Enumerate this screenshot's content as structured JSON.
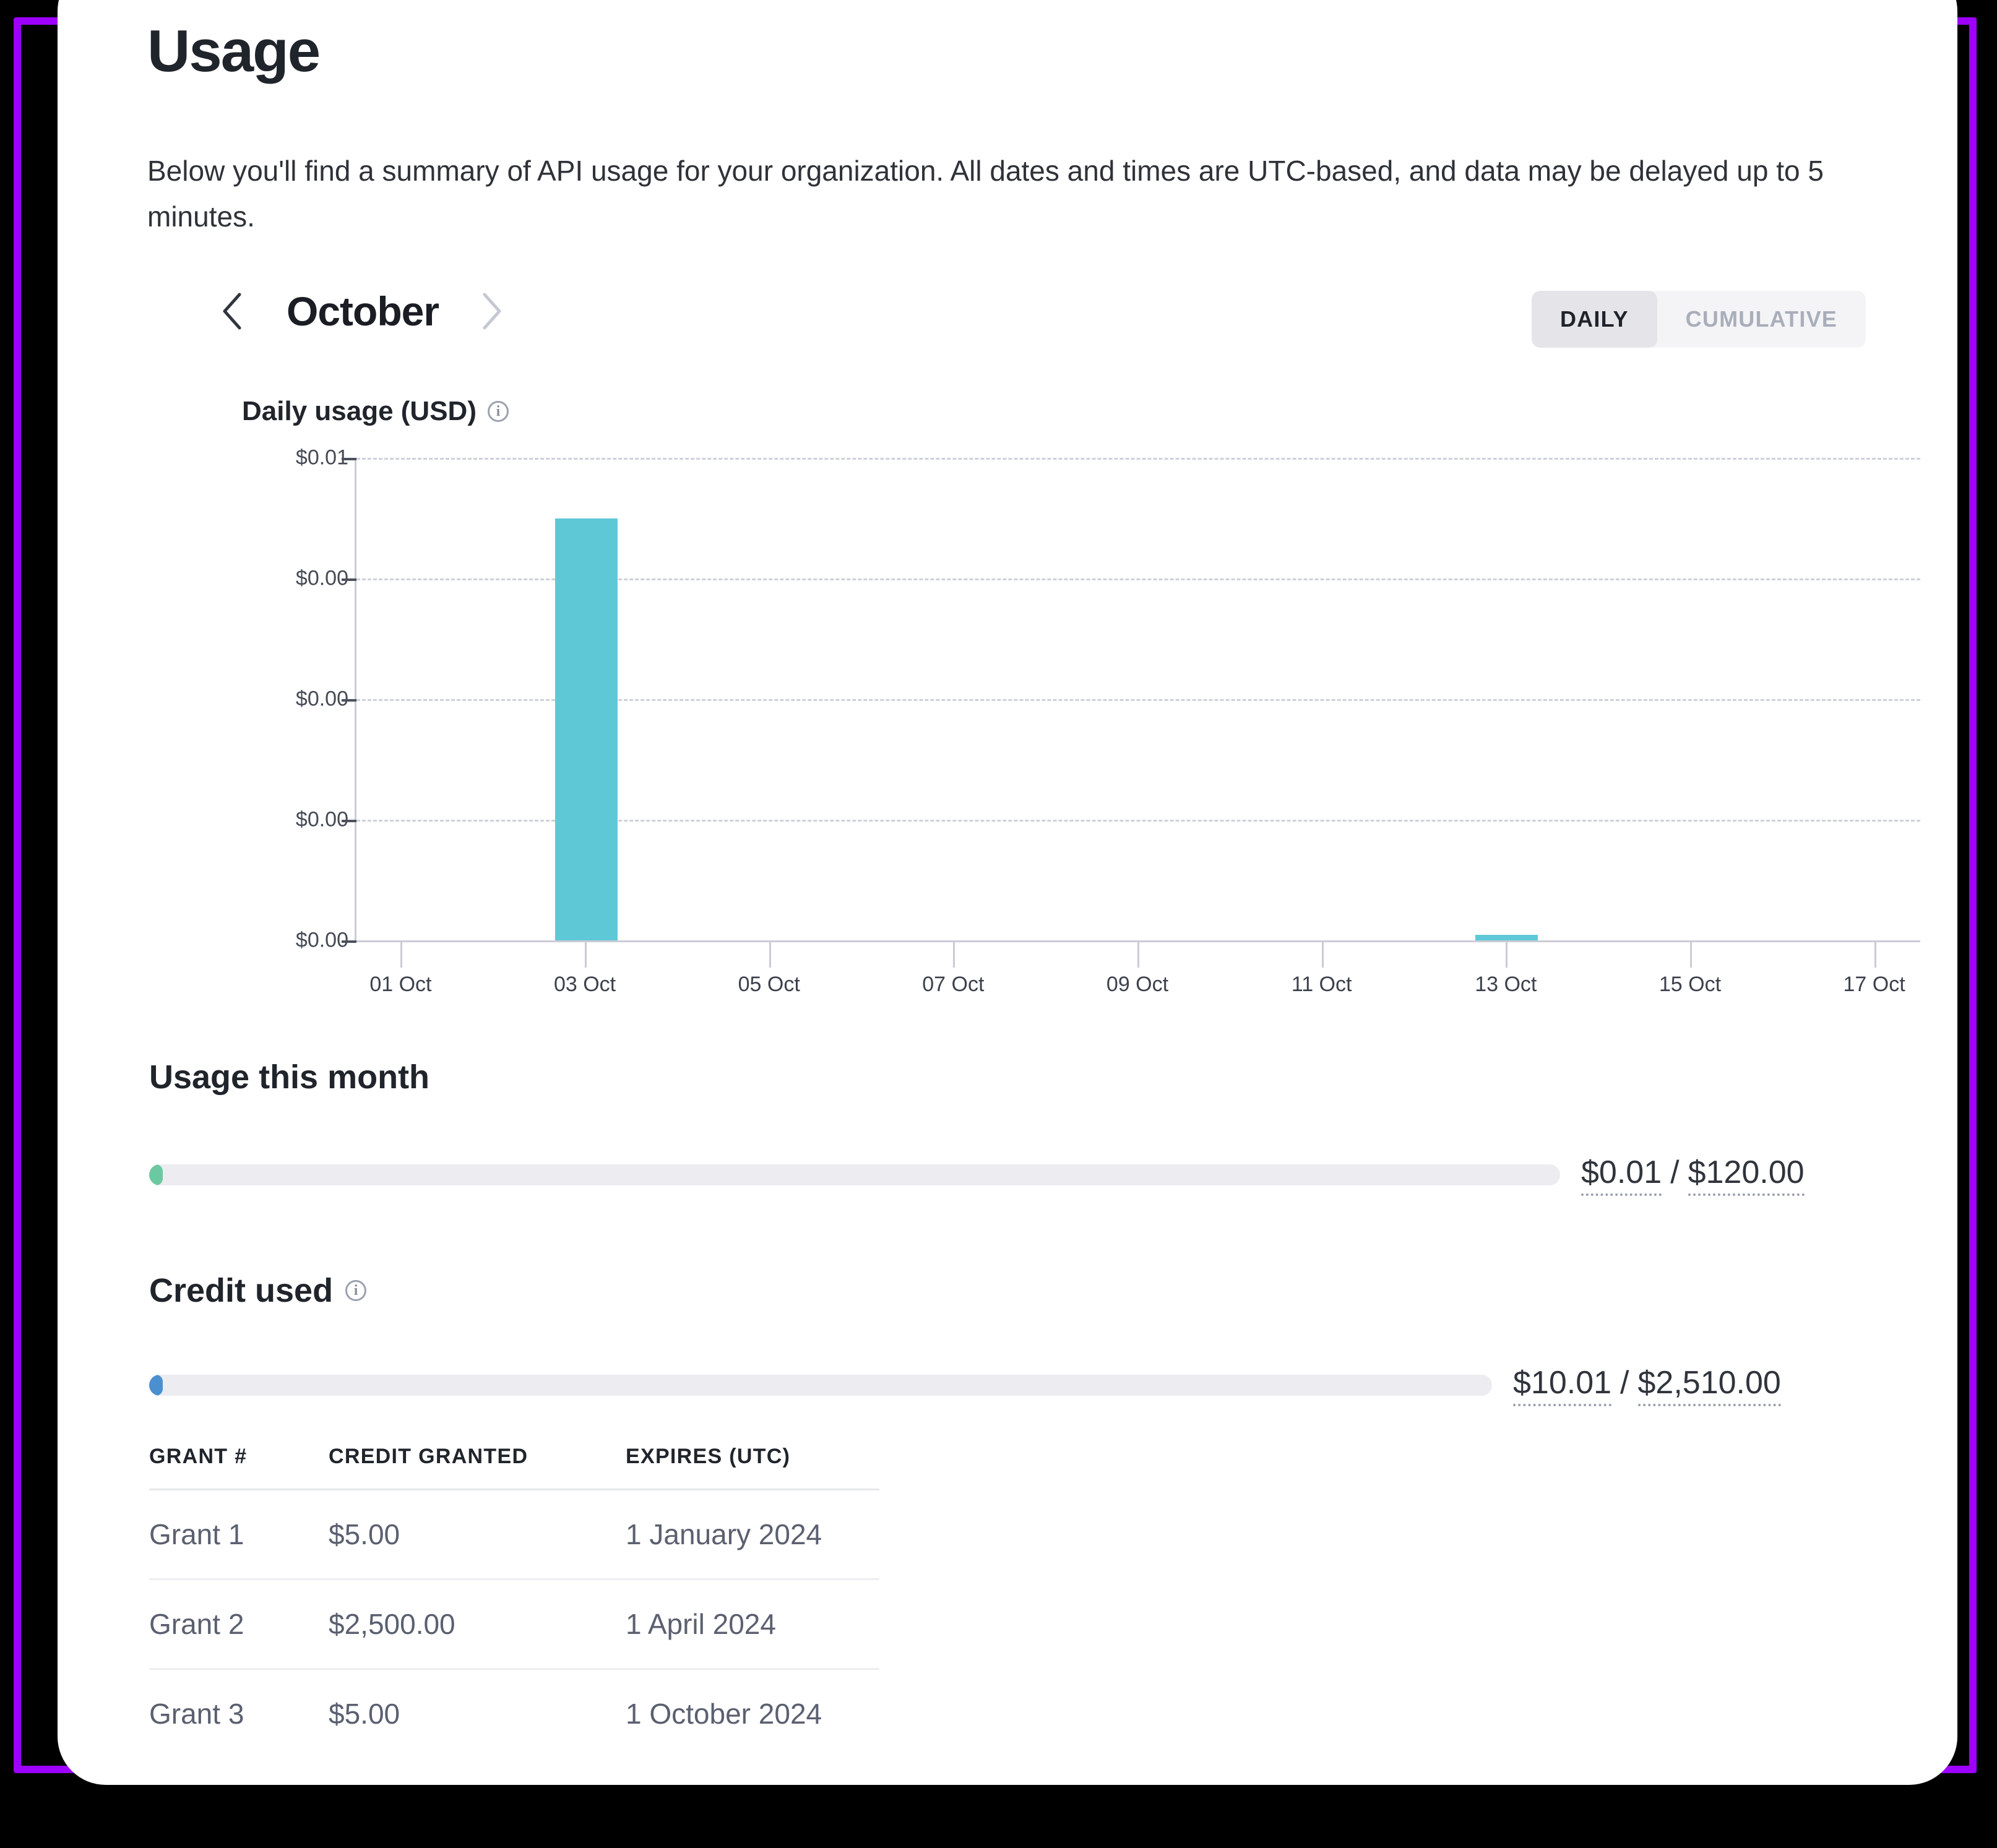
{
  "frame": {
    "border_color": "#9E00FF",
    "background_color": "#000000"
  },
  "page": {
    "title": "Usage",
    "description": "Below you'll find a summary of API usage for your organization. All dates and times are UTC-based, and data may be delayed up to 5 minutes."
  },
  "month_nav": {
    "prev_label": "‹",
    "next_label": "›",
    "current_month": "October"
  },
  "view_toggle": {
    "options": [
      {
        "label": "DAILY",
        "selected": true
      },
      {
        "label": "CUMULATIVE",
        "selected": false
      }
    ]
  },
  "chart_block": {
    "title": "Daily usage (USD)",
    "info_icon": "info-icon",
    "info_glyph": "i"
  },
  "chart_data": {
    "type": "bar",
    "title": "Daily usage (USD)",
    "xlabel": "",
    "ylabel": "",
    "grid": true,
    "legend": false,
    "bar_color": "#5FC8D6",
    "ylim": [
      0,
      0.01
    ],
    "ytick_labels": [
      "$0.01",
      "$0.00",
      "$0.00",
      "$0.00",
      "$0.00"
    ],
    "ytick_values": [
      0.01,
      0.0075,
      0.005,
      0.0025,
      0
    ],
    "xtick_labels": [
      "01 Oct",
      "03 Oct",
      "05 Oct",
      "07 Oct",
      "09 Oct",
      "11 Oct",
      "13 Oct",
      "15 Oct",
      "17 Oct"
    ],
    "categories": [
      "01 Oct",
      "02 Oct",
      "03 Oct",
      "04 Oct",
      "05 Oct",
      "06 Oct",
      "07 Oct",
      "08 Oct",
      "09 Oct",
      "10 Oct",
      "11 Oct",
      "12 Oct",
      "13 Oct",
      "14 Oct",
      "15 Oct",
      "16 Oct",
      "17 Oct"
    ],
    "values": [
      0,
      0,
      0.00875,
      0,
      0,
      0,
      0,
      0,
      0,
      0,
      0,
      0,
      0.00012,
      0,
      0,
      0,
      0
    ]
  },
  "usage_section": {
    "heading": "Usage this month",
    "used": "$0.01",
    "separator": "/",
    "limit": "$120.00",
    "percent": 0.8,
    "fill_color": "#6BC9A1"
  },
  "credit_section": {
    "heading": "Credit used",
    "info_glyph": "i",
    "used": "$10.01",
    "separator": "/",
    "limit": "$2,510.00",
    "percent": 0.9,
    "fill_color": "#4A90D0"
  },
  "grants_table": {
    "columns": [
      "GRANT #",
      "CREDIT GRANTED",
      "EXPIRES (UTC)"
    ],
    "rows": [
      {
        "grant": "Grant 1",
        "credit": "$5.00",
        "expires": "1 January 2024"
      },
      {
        "grant": "Grant 2",
        "credit": "$2,500.00",
        "expires": "1 April 2024"
      },
      {
        "grant": "Grant 3",
        "credit": "$5.00",
        "expires": "1 October 2024"
      }
    ]
  }
}
